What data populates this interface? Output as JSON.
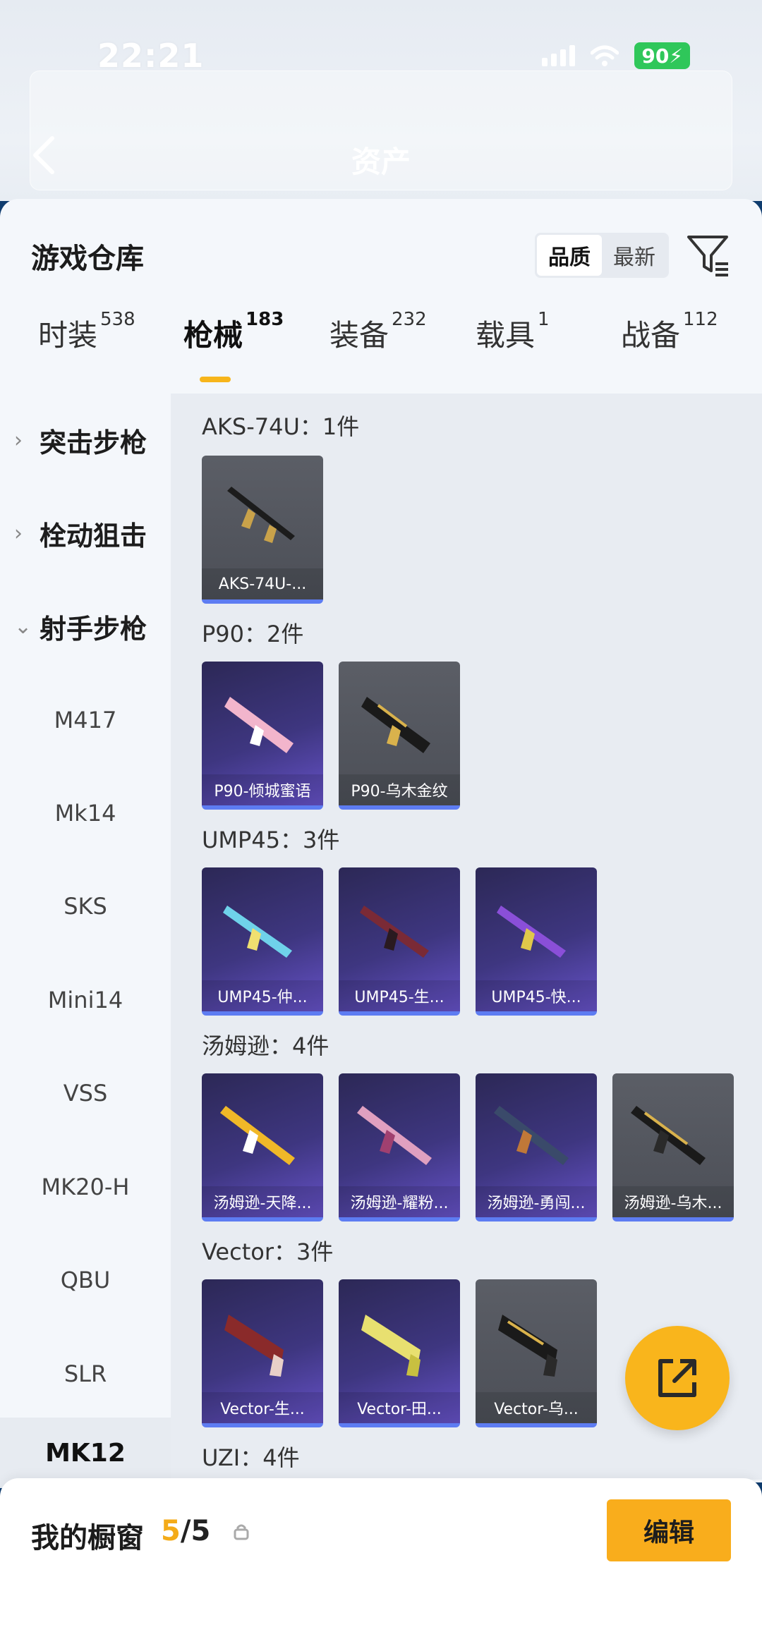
{
  "status_bar": {
    "time": "22:21",
    "battery": "90"
  },
  "header": {
    "title": "资产"
  },
  "warehouse": {
    "title": "游戏仓库",
    "sort_options": [
      "品质",
      "最新"
    ],
    "active_sort": "品质"
  },
  "tabs": [
    {
      "label": "时装",
      "count": "538"
    },
    {
      "label": "枪械",
      "count": "183"
    },
    {
      "label": "装备",
      "count": "232"
    },
    {
      "label": "载具",
      "count": "1"
    },
    {
      "label": "战备",
      "count": "112"
    }
  ],
  "active_tab": "枪械",
  "sidebar": {
    "categories": [
      {
        "label": "突击步枪",
        "expanded": false
      },
      {
        "label": "栓动狙击",
        "expanded": false
      },
      {
        "label": "射手步枪",
        "expanded": true
      }
    ],
    "items": [
      "M417",
      "Mk14",
      "SKS",
      "Mini14",
      "VSS",
      "MK20-H",
      "QBU",
      "SLR",
      "MK12"
    ],
    "selected_item": "MK12"
  },
  "groups": [
    {
      "title": "AKS-74U：1件",
      "cards": [
        {
          "label": "AKS-74U-...",
          "style": "grey"
        }
      ]
    },
    {
      "title": "P90：2件",
      "cards": [
        {
          "label": "P90-倾城蜜语",
          "style": "purple"
        },
        {
          "label": "P90-乌木金纹",
          "style": "grey"
        }
      ]
    },
    {
      "title": "UMP45：3件",
      "cards": [
        {
          "label": "UMP45-仲...",
          "style": "purple"
        },
        {
          "label": "UMP45-生...",
          "style": "purple"
        },
        {
          "label": "UMP45-快...",
          "style": "purple"
        }
      ]
    },
    {
      "title": "汤姆逊：4件",
      "cards": [
        {
          "label": "汤姆逊-天降...",
          "style": "purple"
        },
        {
          "label": "汤姆逊-耀粉...",
          "style": "purple"
        },
        {
          "label": "汤姆逊-勇闯...",
          "style": "purple"
        },
        {
          "label": "汤姆逊-乌木...",
          "style": "grey"
        }
      ]
    },
    {
      "title": "Vector：3件",
      "cards": [
        {
          "label": "Vector-生...",
          "style": "purple"
        },
        {
          "label": "Vector-田...",
          "style": "purple"
        },
        {
          "label": "Vector-乌...",
          "style": "grey"
        }
      ]
    },
    {
      "title": "UZI：4件",
      "cards": []
    }
  ],
  "showcase": {
    "label": "我的橱窗",
    "count_filled": "5",
    "count_sep_total": "/5",
    "edit_label": "编辑"
  },
  "colors": {
    "accent": "#f9b51c",
    "card_bar": "#5d7cf2",
    "battery": "#2fc75a"
  },
  "icons": [
    "back-arrow-icon",
    "filter-icon",
    "share-icon",
    "lock-icon",
    "chevron-right-icon",
    "chevron-down-icon"
  ]
}
